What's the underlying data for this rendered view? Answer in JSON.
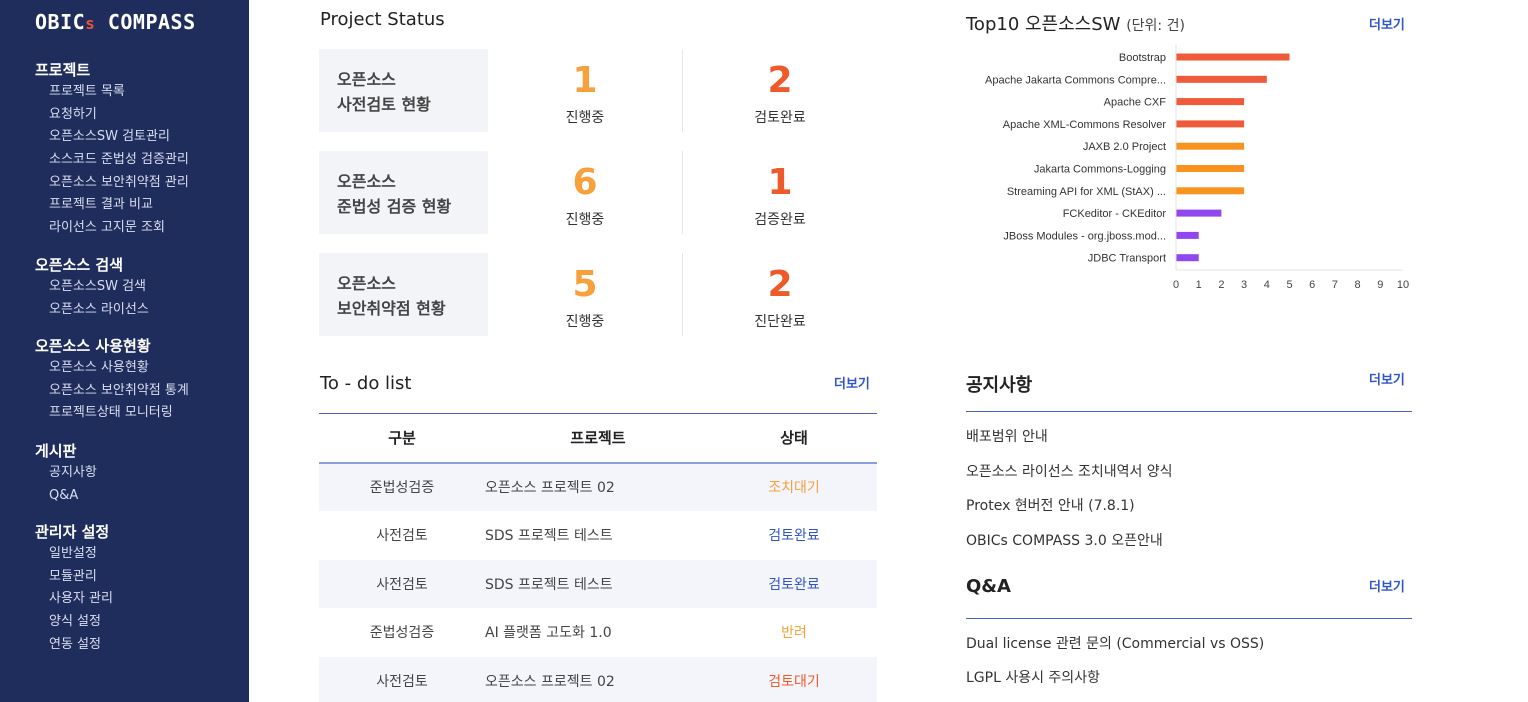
{
  "sidebar": {
    "logo_main": "OBIC",
    "logo_s": "s",
    "logo_rest": " COMPASS",
    "sections": [
      {
        "title": "프로젝트",
        "items": [
          "프로젝트 목록",
          "요청하기",
          "오픈소스SW 검토관리",
          "소스코드 준법성 검증관리",
          "오픈소스 보안취약점 관리",
          "프로젝트 결과 비교",
          "라이선스 고지문 조회"
        ]
      },
      {
        "title": "오픈소스 검색",
        "items": [
          "오픈소스SW 검색",
          "오픈소스 라이선스"
        ]
      },
      {
        "title": "오픈소스 사용현황",
        "items": [
          "오픈소스 사용현황",
          "오픈소스 보안취약점 통계",
          "프로젝트상태 모니터링"
        ]
      },
      {
        "title": "게시판",
        "items": [
          "공지사항",
          "Q&A"
        ]
      },
      {
        "title": "관리자 설정",
        "items": [
          "일반설정",
          "모듈관리",
          "사용자 관리",
          "양식 설정",
          "연동 설정"
        ]
      }
    ]
  },
  "project_status": {
    "title": "Project Status",
    "cards": [
      {
        "label1": "오픈소스",
        "label2": "사전검토 현황",
        "n1": "1",
        "cap1": "진행중",
        "n2": "2",
        "cap2": "검토완료"
      },
      {
        "label1": "오픈소스",
        "label2": "준법성 검증 현황",
        "n1": "6",
        "cap1": "진행중",
        "n2": "1",
        "cap2": "검증완료"
      },
      {
        "label1": "오픈소스",
        "label2": "보안취약점 현황",
        "n1": "5",
        "cap1": "진행중",
        "n2": "2",
        "cap2": "진단완료"
      }
    ]
  },
  "todo": {
    "title": "To - do list",
    "more": "더보기",
    "headers": [
      "구분",
      "프로젝트",
      "상태"
    ],
    "rows": [
      {
        "type": "준법성검증",
        "project": "오픈소스 프로젝트 02",
        "status": "조치대기",
        "status_color": "#f7a03c"
      },
      {
        "type": "사전검토",
        "project": "SDS 프로젝트 테스트",
        "status": "검토완료",
        "status_color": "#2f55c9"
      },
      {
        "type": "사전검토",
        "project": "SDS 프로젝트 테스트",
        "status": "검토완료",
        "status_color": "#2f55c9"
      },
      {
        "type": "준법성검증",
        "project": "AI 플랫폼 고도화 1.0",
        "status": "반려",
        "status_color": "#f7a03c"
      },
      {
        "type": "사전검토",
        "project": "오픈소스 프로젝트 02",
        "status": "검토대기",
        "status_color": "#ef5a2b"
      }
    ]
  },
  "chart_section": {
    "title": "Top10 오픈소스SW",
    "unit": "(단위: 건)",
    "more": "더보기"
  },
  "chart_data": {
    "type": "bar",
    "orientation": "horizontal",
    "categories": [
      "Bootstrap",
      "Apache Jakarta Commons Compre...",
      "Apache CXF",
      "Apache XML-Commons Resolver",
      "JAXB 2.0 Project",
      "Jakarta Commons-Logging",
      "Streaming API for XML (StAX) ...",
      "FCKeditor - CKEditor",
      "JBoss Modules - org.jboss.mod...",
      "JDBC Transport"
    ],
    "values": [
      5,
      4,
      3,
      3,
      3,
      3,
      3,
      2,
      1,
      1
    ],
    "colors": [
      "#ef5a3a",
      "#ef5a3a",
      "#ef5a3a",
      "#ef5a3a",
      "#f7931e",
      "#f7931e",
      "#f7931e",
      "#9146f0",
      "#9146f0",
      "#9146f0"
    ],
    "xlim": [
      0,
      10
    ],
    "xticks": [
      "0",
      "1",
      "2",
      "3",
      "4",
      "5",
      "6",
      "7",
      "8",
      "9",
      "10"
    ],
    "title": "",
    "xlabel": "",
    "ylabel": "",
    "grid": false
  },
  "notice": {
    "title": "공지사항",
    "more": "더보기",
    "items": [
      "배포범위 안내",
      "오픈소스 라이선스 조치내역서 양식",
      "Protex 현버전 안내 (7.8.1)",
      "OBICs COMPASS 3.0 오픈안내"
    ]
  },
  "qna": {
    "title": "Q&A",
    "more": "더보기",
    "items": [
      "Dual license 관련 문의 (Commercial vs OSS)",
      "LGPL 사용시 주의사항"
    ]
  }
}
